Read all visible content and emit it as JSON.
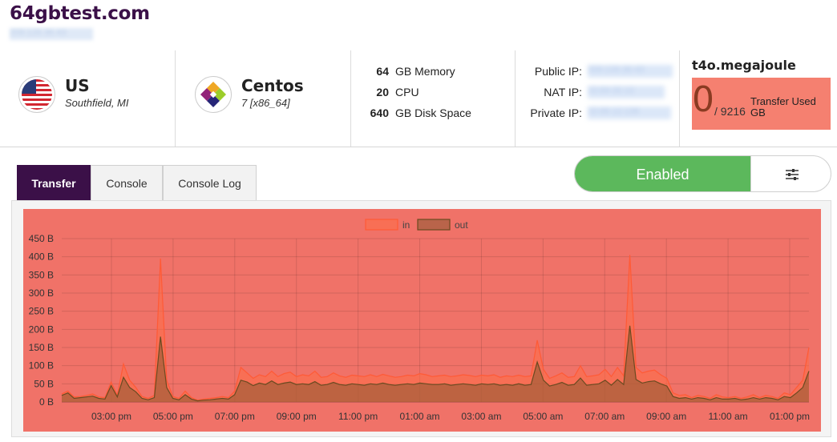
{
  "site": {
    "title": "64gbtest.com",
    "ip_blurred": "209.126.36.43"
  },
  "location": {
    "country": "US",
    "city": "Southfield, MI",
    "flag_icon": "us-flag-icon"
  },
  "os": {
    "name": "Centos",
    "version": "7 [x86_64]",
    "logo_icon": "centos-logo-icon"
  },
  "specs": [
    {
      "value": "64",
      "label": "GB Memory"
    },
    {
      "value": "20",
      "label": "CPU"
    },
    {
      "value": "640",
      "label": "GB Disk Space"
    }
  ],
  "network": {
    "public_label": "Public IP:",
    "public_value": "209.126.36.43",
    "nat_label": "NAT IP:",
    "nat_value": "10.64.32.12",
    "private_label": "Private IP:",
    "private_value": "10.66.12.136"
  },
  "host": {
    "name": "t4o.megajoule",
    "transfer_used": "0",
    "transfer_total": "/ 9216",
    "transfer_label": "Transfer Used GB"
  },
  "tabs": [
    {
      "label": "Transfer",
      "active": true
    },
    {
      "label": "Console",
      "active": false
    },
    {
      "label": "Console Log",
      "active": false
    }
  ],
  "controls": {
    "enabled_label": "Enabled",
    "settings_icon": "sliders-icon"
  },
  "colors": {
    "brand": "#3b1048",
    "enabled": "#5cb85c",
    "transfer_box": "#f58070",
    "chart_bg": "#f07268",
    "in_line": "#ff5a36",
    "out_line": "#6b4a20"
  },
  "chart_data": {
    "type": "area",
    "title": "",
    "xlabel": "",
    "ylabel": "",
    "ylim": [
      0,
      450
    ],
    "yticks": [
      "0 B",
      "50 B",
      "100 B",
      "150 B",
      "200 B",
      "250 B",
      "300 B",
      "350 B",
      "400 B",
      "450 B"
    ],
    "xticks": [
      "03:00 pm",
      "05:00 pm",
      "07:00 pm",
      "09:00 pm",
      "11:00 pm",
      "01:00 am",
      "03:00 am",
      "05:00 am",
      "07:00 am",
      "09:00 am",
      "11:00 am",
      "01:00 pm"
    ],
    "legend": "top",
    "grid": true,
    "series": [
      {
        "name": "in",
        "values": [
          22,
          30,
          14,
          15,
          18,
          22,
          14,
          12,
          55,
          18,
          105,
          60,
          40,
          15,
          10,
          18,
          395,
          60,
          15,
          10,
          30,
          12,
          5,
          8,
          10,
          12,
          15,
          12,
          30,
          95,
          80,
          65,
          75,
          70,
          85,
          70,
          78,
          82,
          70,
          75,
          72,
          85,
          68,
          70,
          80,
          72,
          68,
          74,
          72,
          70,
          75,
          70,
          76,
          72,
          68,
          70,
          74,
          72,
          78,
          75,
          70,
          72,
          74,
          70,
          72,
          75,
          73,
          70,
          74,
          72,
          75,
          68,
          72,
          70,
          74,
          70,
          72,
          170,
          90,
          65,
          72,
          80,
          68,
          70,
          100,
          70,
          72,
          75,
          90,
          70,
          95,
          72,
          405,
          95,
          80,
          85,
          88,
          75,
          65,
          25,
          18,
          20,
          12,
          18,
          15,
          10,
          20,
          14,
          12,
          15,
          10,
          14,
          20,
          12,
          18,
          15,
          10,
          25,
          20,
          40,
          60,
          150
        ]
      },
      {
        "name": "out",
        "values": [
          18,
          25,
          10,
          12,
          14,
          16,
          10,
          8,
          45,
          14,
          68,
          40,
          28,
          10,
          6,
          12,
          180,
          40,
          10,
          6,
          20,
          8,
          3,
          5,
          6,
          8,
          10,
          8,
          20,
          60,
          55,
          45,
          52,
          48,
          58,
          48,
          52,
          55,
          48,
          50,
          48,
          56,
          46,
          48,
          54,
          48,
          46,
          50,
          48,
          46,
          50,
          48,
          52,
          48,
          46,
          48,
          50,
          48,
          52,
          50,
          48,
          48,
          50,
          46,
          48,
          50,
          48,
          46,
          50,
          48,
          50,
          46,
          48,
          46,
          50,
          46,
          48,
          110,
          60,
          44,
          48,
          54,
          46,
          48,
          66,
          46,
          48,
          50,
          60,
          46,
          62,
          48,
          210,
          62,
          52,
          56,
          58,
          50,
          44,
          15,
          10,
          12,
          8,
          12,
          10,
          6,
          12,
          8,
          8,
          10,
          6,
          8,
          12,
          8,
          12,
          10,
          6,
          15,
          12,
          25,
          40,
          85
        ]
      }
    ]
  }
}
